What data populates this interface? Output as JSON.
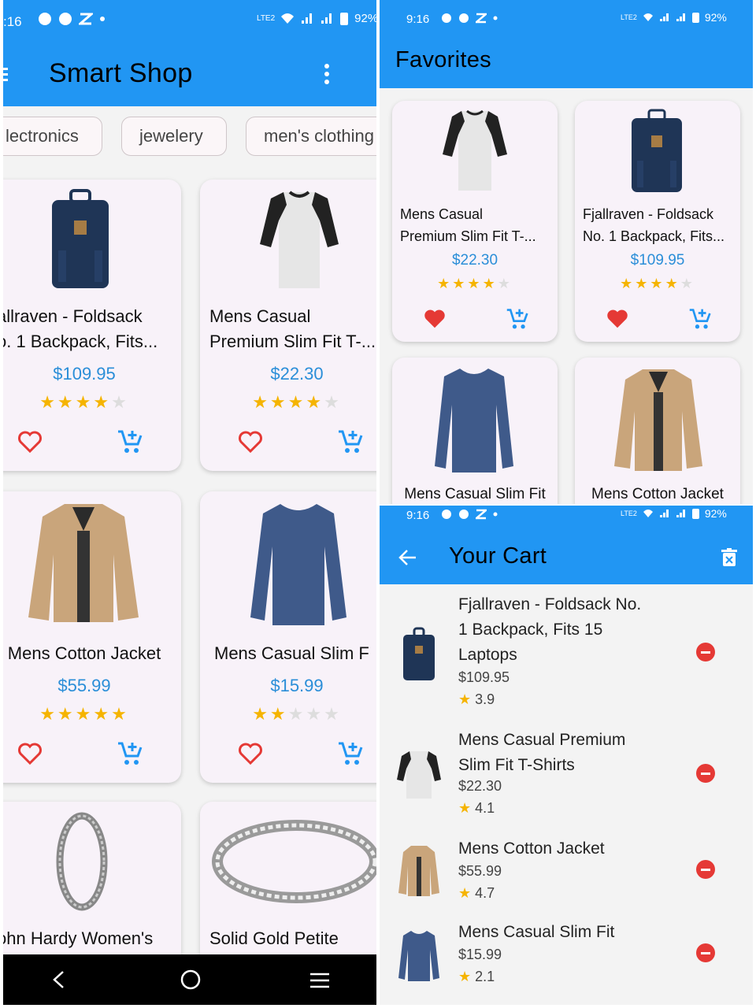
{
  "status": {
    "time": "9:16",
    "time_p1": ":16",
    "battery": "92%",
    "battery_p1": "92%",
    "net": "LTE2"
  },
  "shop": {
    "title": "Smart Shop",
    "categories": [
      "lectronics",
      "jewelery",
      "men's clothing"
    ],
    "products": [
      {
        "name": "allraven - Foldsack\no. 1 Backpack, Fits...",
        "price": "$109.95",
        "rating": 4
      },
      {
        "name": "Mens Casual\nPremium Slim Fit T-...",
        "price": "$22.30",
        "rating": 4
      },
      {
        "name": "Mens Cotton Jacket",
        "price": "$55.99",
        "rating": 5
      },
      {
        "name": "Mens Casual Slim F",
        "price": "$15.99",
        "rating": 2
      },
      {
        "name": "ohn Hardy Women's",
        "price": "",
        "rating": 0
      },
      {
        "name": "Solid Gold Petite",
        "price": "",
        "rating": 0
      }
    ]
  },
  "favorites": {
    "title": "Favorites",
    "items": [
      {
        "name": "Mens Casual\nPremium Slim Fit T-...",
        "price": "$22.30",
        "rating": 4
      },
      {
        "name": "Fjallraven - Foldsack\nNo. 1 Backpack, Fits...",
        "price": "$109.95",
        "rating": 4
      },
      {
        "name": "Mens Casual Slim Fit",
        "price": "",
        "rating": 0
      },
      {
        "name": "Mens Cotton Jacket",
        "price": "",
        "rating": 0
      }
    ]
  },
  "cart": {
    "title": "Your Cart",
    "items": [
      {
        "name": "Fjallraven - Foldsack No.\n1 Backpack, Fits 15\nLaptops",
        "price": "$109.95",
        "rating": "3.9"
      },
      {
        "name": "Mens Casual Premium\nSlim Fit T-Shirts",
        "price": "$22.30",
        "rating": "4.1"
      },
      {
        "name": "Mens Cotton Jacket",
        "price": "$55.99",
        "rating": "4.7"
      },
      {
        "name": "Mens Casual Slim Fit",
        "price": "$15.99",
        "rating": "2.1"
      }
    ]
  },
  "colors": {
    "primary": "#2196f3",
    "price": "#2a8ed8",
    "heart": "#e53935",
    "star": "#f5b400"
  }
}
